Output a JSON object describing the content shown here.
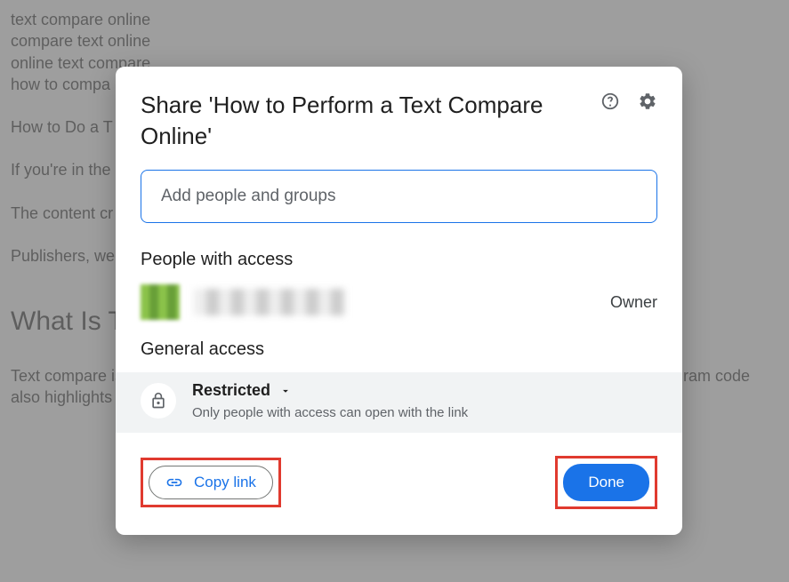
{
  "background": {
    "keywords": [
      "text compare online",
      "compare text online",
      "online text compare",
      "how to compa"
    ],
    "heading_partial": "How to Do a T",
    "para1": "If you're in the … must face the … These easy an",
    "para2": "The content cr … else's work as … other publishin",
    "para3": "Publishers, we … the submitted … content and al … engines, and t",
    "section_heading": "What Is Te",
    "para4": "Text compare is a process of using a software program to visualize texts side by side. The program code also highlights similar words, phrases, and sentences in compared texts."
  },
  "dialog": {
    "title": "Share 'How to Perform a Text Compare Online'",
    "input_placeholder": "Add people and groups",
    "people_section": "People with access",
    "owner_role": "Owner",
    "general_section": "General access",
    "access_level": "Restricted",
    "access_description": "Only people with access can open with the link",
    "copy_link": "Copy link",
    "done": "Done"
  }
}
